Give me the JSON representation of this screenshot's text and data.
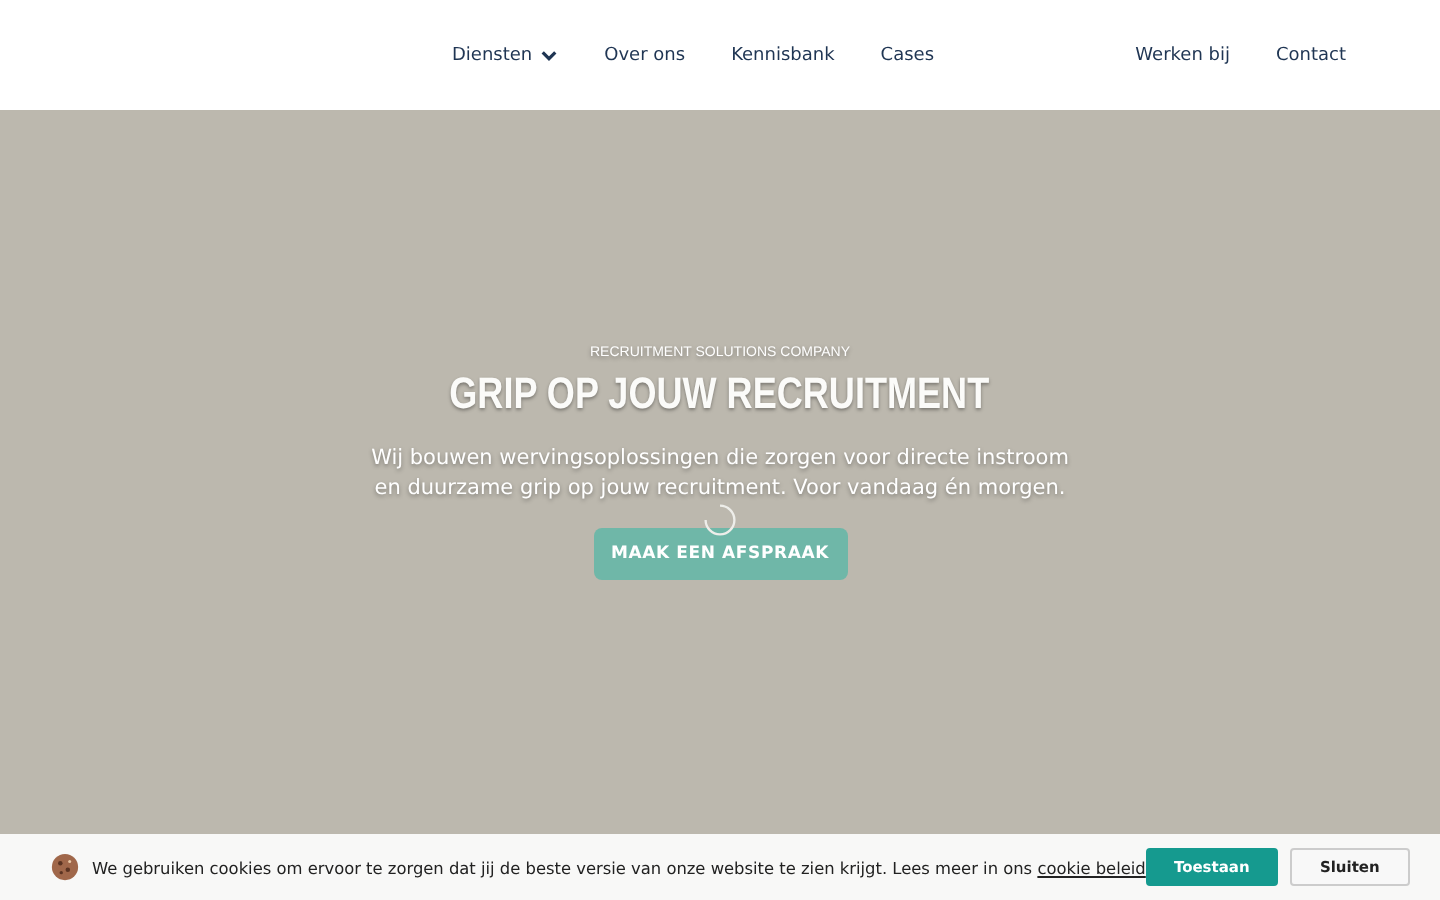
{
  "nav": {
    "items": [
      {
        "label": "Diensten",
        "dropdown": true
      },
      {
        "label": "Over ons",
        "dropdown": false
      },
      {
        "label": "Kennisbank",
        "dropdown": false
      },
      {
        "label": "Cases",
        "dropdown": false
      }
    ],
    "right_items": [
      {
        "label": "Werken bij"
      },
      {
        "label": "Contact"
      }
    ]
  },
  "hero": {
    "eyebrow": "RECRUITMENT SOLUTIONS COMPANY",
    "title": "GRIP OP JOUW RECRUITMENT",
    "text": "Wij bouwen wervingsoplossingen die zorgen voor directe instroom en duurzame grip op jouw recruitment. Voor vandaag én morgen.",
    "button": "MAAK EEN AFSPRAAK",
    "loading": true
  },
  "cookie_bar": {
    "text": "We gebruiken cookies om ervoor te zorgen dat jij de beste versie van onze website te zien krijgt. Lees meer in ons",
    "link": "cookie beleid",
    "buttons": [
      {
        "label": "Toestaan",
        "kind": "primary"
      },
      {
        "label": "Sluiten",
        "kind": "secondary"
      }
    ]
  }
}
